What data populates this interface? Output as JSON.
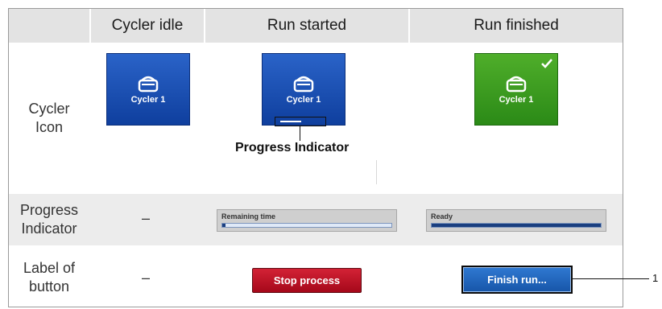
{
  "columns": {
    "idle": "Cycler idle",
    "started": "Run started",
    "finished": "Run finished"
  },
  "rows": {
    "icon": "Cycler\nIcon",
    "progress": "Progress\nIndicator",
    "label": "Label of\nbutton"
  },
  "cycler_name": "Cycler 1",
  "callout_progress": "Progress Indicator",
  "progress": {
    "idle": "–",
    "started_text": "Remaining time",
    "started_fill": 0.02,
    "finished_text": "Ready",
    "finished_fill": 1.0
  },
  "buttons": {
    "idle": "–",
    "stop": "Stop process",
    "finish": "Finish run..."
  },
  "callout_number": "1",
  "colors": {
    "header_bg": "#e3e3e3",
    "tile_blue": "#1f56b8",
    "tile_green": "#3c9c22",
    "stop_red": "#c0182b",
    "finish_blue": "#2466bd"
  },
  "icons": {
    "cycler": "cycler-icon",
    "check": "checkmark-icon"
  }
}
